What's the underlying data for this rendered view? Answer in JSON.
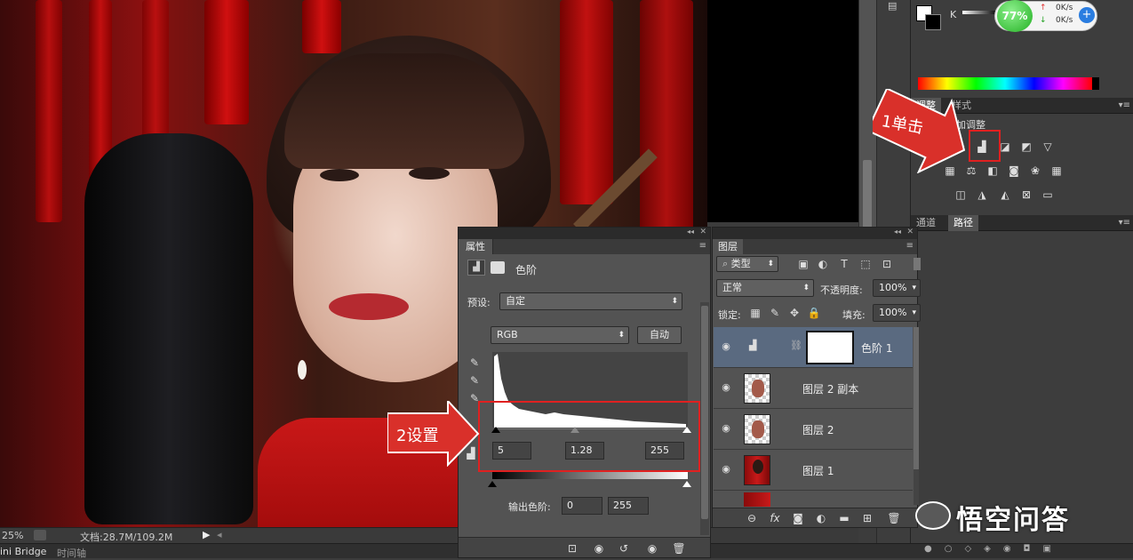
{
  "canvas": {
    "zoom": "25%",
    "doc_info": "文档:28.7M/109.2M"
  },
  "bottom_tabs": [
    "ini Bridge",
    "时间轴"
  ],
  "color_panel": {
    "channel": "K"
  },
  "net_monitor": {
    "percent": "77%",
    "up": "0K/s",
    "down": "0K/s"
  },
  "adjustments_panel": {
    "tabs": [
      "调整",
      "样式"
    ],
    "title_partial": "添加调整"
  },
  "paths_panel": {
    "tabs": [
      "通道",
      "路径"
    ]
  },
  "properties": {
    "tab": "属性",
    "type_label": "色阶",
    "preset_label": "预设:",
    "preset_value": "自定",
    "channel": "RGB",
    "auto_button": "自动",
    "input_levels": [
      "5",
      "1.28",
      "255"
    ],
    "output_label": "输出色阶:",
    "output_levels": [
      "0",
      "255"
    ]
  },
  "layers": {
    "tab": "图层",
    "filter_type": "类型",
    "blend_mode": "正常",
    "opacity_label": "不透明度:",
    "opacity": "100%",
    "lock_label": "锁定:",
    "fill_label": "填充:",
    "fill": "100%",
    "items": [
      {
        "name": "色阶 1",
        "selected": true
      },
      {
        "name": "图层 2 副本",
        "selected": false
      },
      {
        "name": "图层 2",
        "selected": false
      },
      {
        "name": "图层 1",
        "selected": false
      }
    ]
  },
  "annotations": {
    "step1": "1单击",
    "step2": "2设置"
  },
  "watermark": "悟空问答",
  "colors": {
    "highlight_red": "#e02020",
    "callout_red": "#d9302a",
    "panel_bg": "#535353"
  }
}
